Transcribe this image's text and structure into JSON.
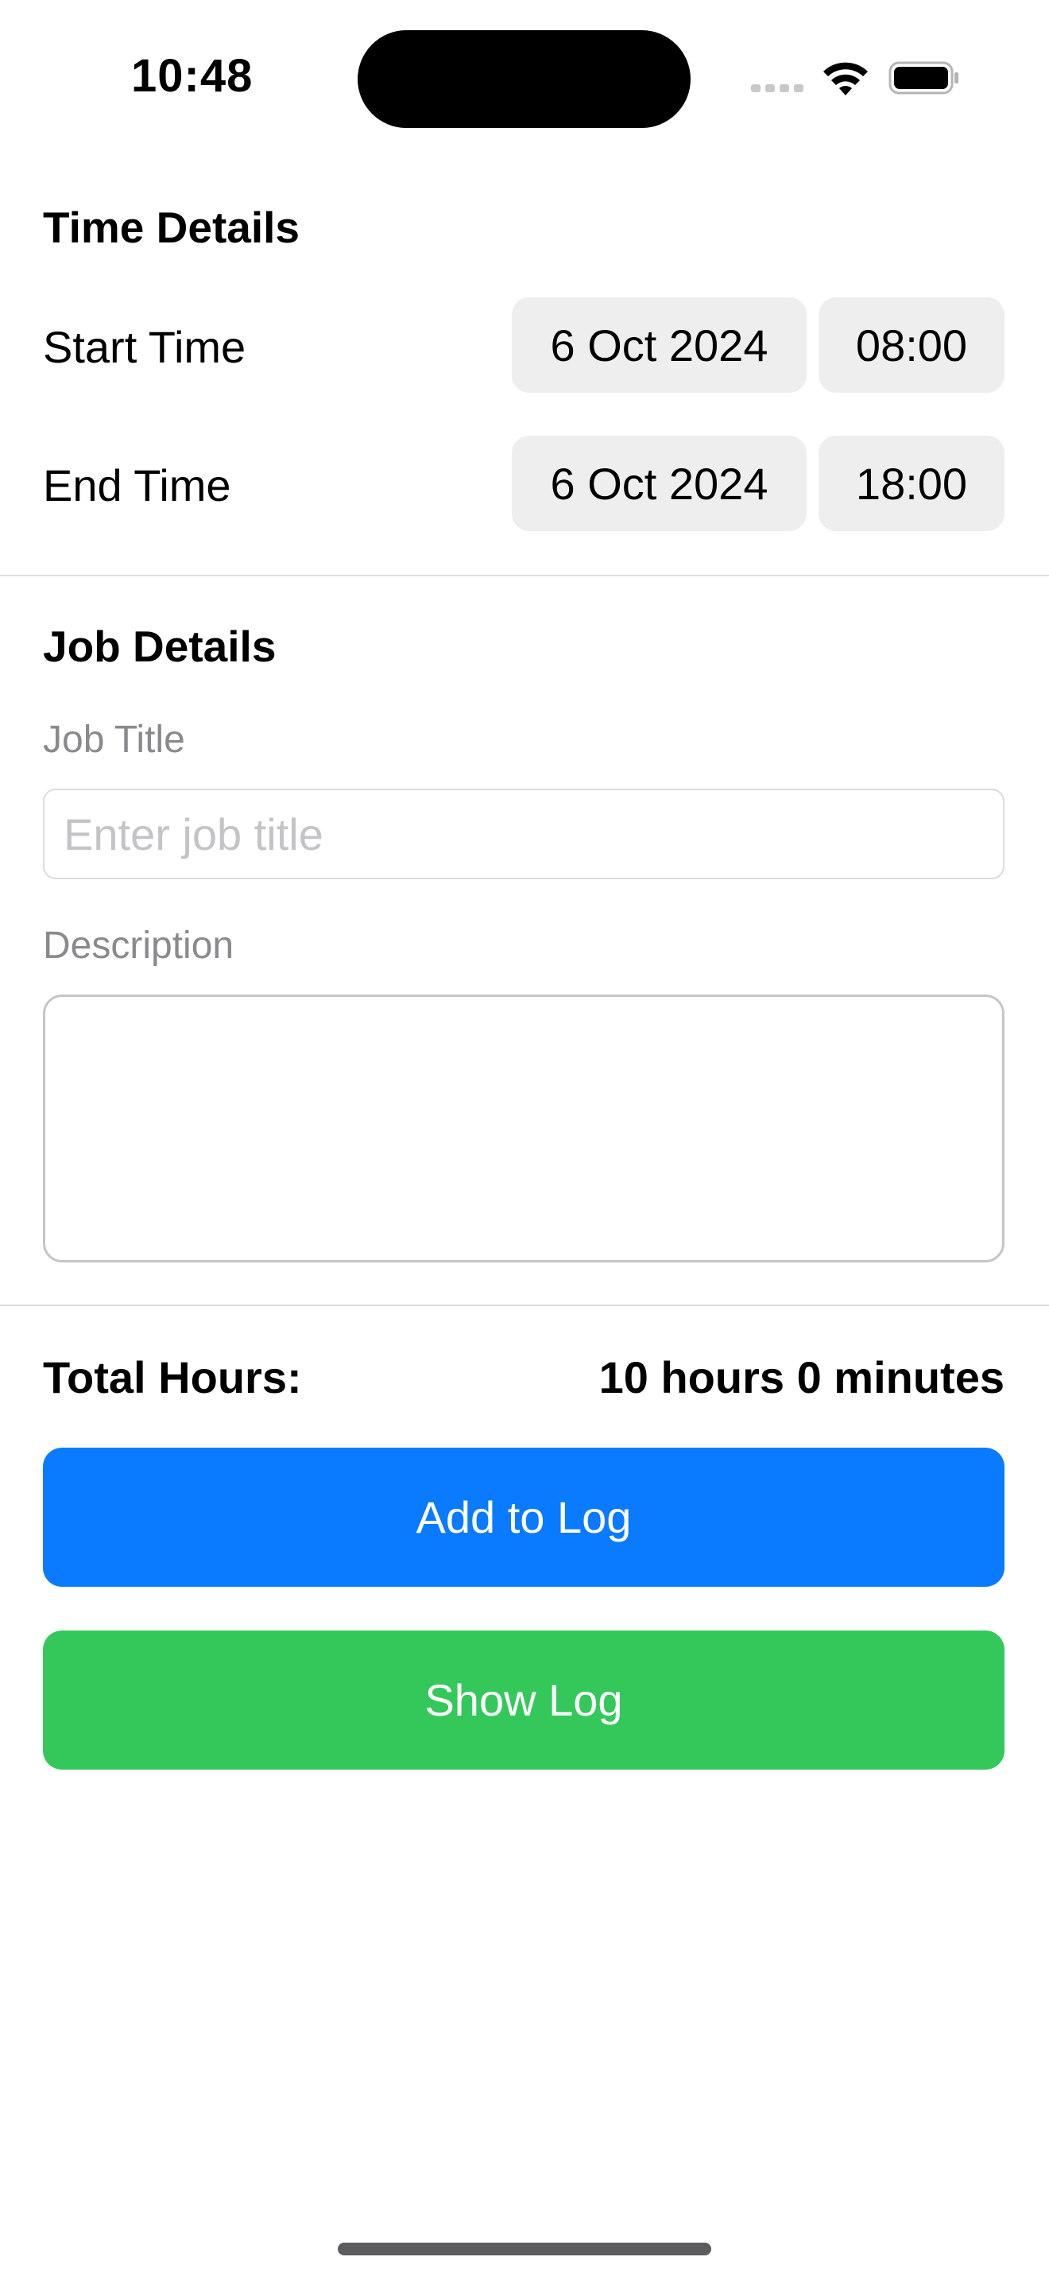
{
  "status_bar": {
    "time": "10:48",
    "icons": [
      "cellular-signal-icon",
      "wifi-icon",
      "battery-icon"
    ]
  },
  "time_details": {
    "title": "Time Details",
    "start": {
      "label": "Start Time",
      "date": "6 Oct 2024",
      "time": "08:00"
    },
    "end": {
      "label": "End Time",
      "date": "6 Oct 2024",
      "time": "18:00"
    }
  },
  "job_details": {
    "title": "Job Details",
    "job_title_label": "Job Title",
    "job_title_value": "",
    "job_title_placeholder": "Enter job title",
    "description_label": "Description",
    "description_value": ""
  },
  "summary": {
    "total_label": "Total Hours:",
    "total_value": "10 hours 0 minutes"
  },
  "actions": {
    "add_label": "Add to Log",
    "show_label": "Show Log"
  },
  "colors": {
    "add_button": "#0a7aff",
    "show_button": "#34c85a",
    "pill_background": "#eeeeef",
    "secondary_text": "#8a8a8e"
  }
}
